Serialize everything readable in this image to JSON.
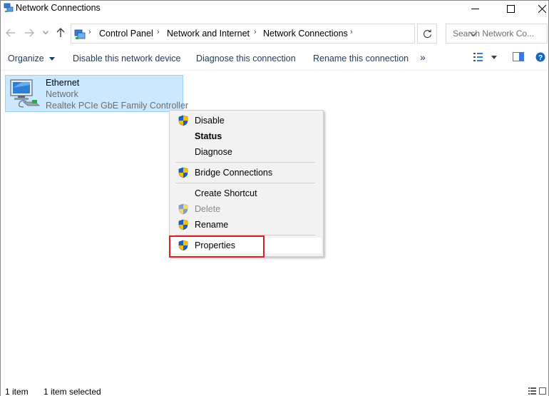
{
  "window": {
    "title": "Network Connections"
  },
  "address": {
    "crumbs": [
      "Control Panel",
      "Network and Internet",
      "Network Connections"
    ],
    "search_placeholder": "Search Network Co..."
  },
  "commands": {
    "organize": "Organize",
    "disable": "Disable this network device",
    "diagnose": "Diagnose this connection",
    "rename": "Rename this connection",
    "more": "»"
  },
  "item": {
    "name": "Ethernet",
    "network": "Network",
    "adapter": "Realtek PCIe GbE Family Controller"
  },
  "context_menu": {
    "items": [
      {
        "label": "Disable",
        "icon": "shield-icon",
        "style": "normal"
      },
      {
        "label": "Status",
        "icon": "",
        "style": "bold"
      },
      {
        "label": "Diagnose",
        "icon": "",
        "style": "normal"
      },
      {
        "label": "Bridge Connections",
        "icon": "shield-icon",
        "style": "normal"
      },
      {
        "label": "Create Shortcut",
        "icon": "",
        "style": "normal"
      },
      {
        "label": "Delete",
        "icon": "shield-icon",
        "style": "disabled"
      },
      {
        "label": "Rename",
        "icon": "shield-icon",
        "style": "normal"
      },
      {
        "label": "Properties",
        "icon": "shield-icon",
        "style": "normal"
      }
    ]
  },
  "status": {
    "count": "1 item",
    "selected": "1 item selected"
  },
  "colors": {
    "selection": "#cce8ff",
    "highlight_border": "#d6202a",
    "command_text": "#1e3a5f"
  }
}
